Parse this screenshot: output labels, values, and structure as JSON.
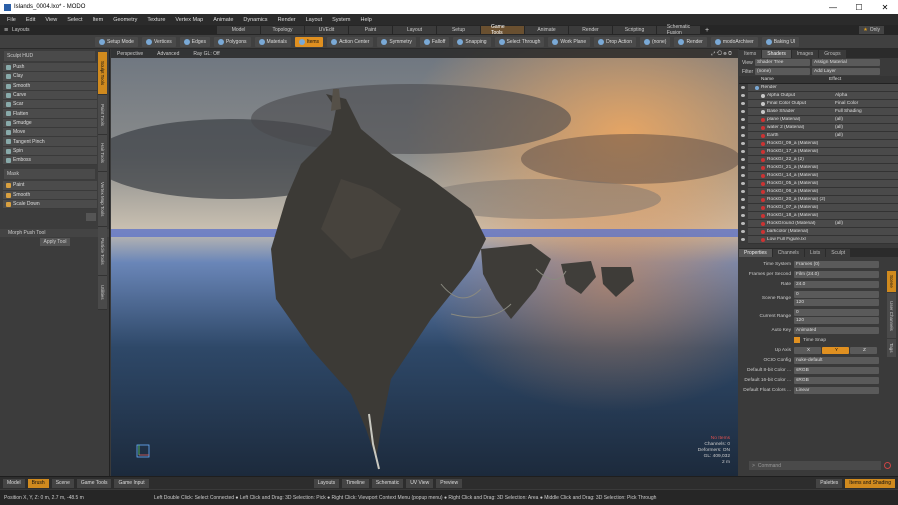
{
  "window": {
    "title": "Islands_0004.lxo* - MODO",
    "min": "—",
    "max": "☐",
    "close": "✕"
  },
  "menu": [
    "File",
    "Edit",
    "View",
    "Select",
    "Item",
    "Geometry",
    "Texture",
    "Vertex Map",
    "Animate",
    "Dynamics",
    "Render",
    "Layout",
    "System",
    "Help"
  ],
  "layouts": {
    "label": "Layouts",
    "tabs": [
      "Model",
      "Topology",
      "UVEdit",
      "Paint",
      "Layout",
      "Setup",
      "Game Tools",
      "Animate",
      "Render",
      "Scripting",
      "Schematic Fusion"
    ],
    "active": "Game Tools",
    "only_label": "Only"
  },
  "toolbar": {
    "items": [
      "Setup Mode",
      "Vertices",
      "Edges",
      "Polygons",
      "Materials",
      "Items",
      "Action Center",
      "Symmetry",
      "Falloff",
      "Snapping",
      "Select Through",
      "Work Plane",
      "Drop Action",
      "(none)",
      "Render",
      "modoArchiver",
      "Baking UI"
    ],
    "active": "Items"
  },
  "left_panel": {
    "header": "Sculpt HUD",
    "tools": [
      "Push",
      "Clay",
      "Smooth",
      "Carve",
      "Scar",
      "Flatten",
      "Smudge",
      "Move",
      "Tangent Pinch",
      "Spin",
      "Emboss"
    ],
    "mask_header": "Mask",
    "mask_tools": [
      "Paint",
      "Smooth",
      "Scale Down"
    ],
    "morph": "Morph Push Tool",
    "apply": "Apply Tool",
    "vtabs": [
      "Sculpt Tools",
      "Paint Tools",
      "Hair Tools",
      "Vertex Map Tools",
      "Particle Tools",
      "Utilities"
    ],
    "vtab_active": "Sculpt Tools"
  },
  "viewport": {
    "view": "Perspective",
    "mode": "Advanced",
    "render": "Ray GL: Off",
    "info": [
      "No Items",
      "Channels: 0",
      "Deformers: ON",
      "GL: 409,032",
      "2 m"
    ]
  },
  "right_panel": {
    "tabs": [
      "Items",
      "Shaders",
      "Images",
      "Groups"
    ],
    "active_tab": "Shaders",
    "view_label": "View",
    "view_value": "Shader Tree",
    "assign": "Assign Material",
    "filter_label": "Filter",
    "filter_value": "(none)",
    "add_layer": "Add Layer",
    "col_name": "Name",
    "col_effect": "Effect",
    "shaders": [
      {
        "name": "Render",
        "effect": "",
        "type": "render"
      },
      {
        "name": "Alpha Output",
        "effect": "Alpha",
        "type": "out"
      },
      {
        "name": "Final Color Output",
        "effect": "Final Color",
        "type": "out"
      },
      {
        "name": "Base Shader",
        "effect": "Full Shading",
        "type": "out"
      },
      {
        "name": "plane (Material)",
        "effect": "(all)",
        "type": "mat"
      },
      {
        "name": "water 2 (Material)",
        "effect": "(all)",
        "type": "mat"
      },
      {
        "name": "Earth",
        "effect": "(all)",
        "type": "mat"
      },
      {
        "name": "RockGr_09_a (Material)",
        "effect": "",
        "type": "mat"
      },
      {
        "name": "RockGr_17_a (Material)",
        "effect": "",
        "type": "mat"
      },
      {
        "name": "RockGr_22_a (2)",
        "effect": "",
        "type": "mat"
      },
      {
        "name": "RockGr_21_a (Material)",
        "effect": "",
        "type": "mat"
      },
      {
        "name": "RockGr_14_a (Material)",
        "effect": "",
        "type": "mat"
      },
      {
        "name": "RockGr_05_a (Material)",
        "effect": "",
        "type": "mat"
      },
      {
        "name": "RockGr_06_a (Material)",
        "effect": "",
        "type": "mat"
      },
      {
        "name": "RockGr_20_a (Material) (2)",
        "effect": "",
        "type": "mat"
      },
      {
        "name": "RockGr_07_a (Material)",
        "effect": "",
        "type": "mat"
      },
      {
        "name": "RockGr_18_a (Material)",
        "effect": "",
        "type": "mat"
      },
      {
        "name": "RockGround (Material)",
        "effect": "(all)",
        "type": "mat"
      },
      {
        "name": "barkcolor (Material)",
        "effect": "",
        "type": "mat"
      },
      {
        "name": "Low Full Figure.lxl",
        "effect": "",
        "type": "mat"
      }
    ],
    "prop_tabs": [
      "Properties",
      "Channels",
      "Lists",
      "Sculpt"
    ],
    "prop_active": "Properties",
    "side_tabs": [
      "Scene",
      "User Channels",
      "Tags"
    ],
    "props": {
      "time_system_label": "Time System",
      "time_system": "Frames (0)",
      "fps_label": "Frames per Second",
      "fps": "Film (24.0)",
      "rate_label": "Rate",
      "rate": "24.0",
      "scene_range_label": "Scene Range",
      "scene_start": "0",
      "scene_end": "120",
      "current_range_label": "Current Range",
      "current_start": "0",
      "current_end": "120",
      "autokey_label": "Auto Key",
      "autokey": "Animated",
      "timesnap": "Time Snap",
      "upaxis_label": "Up Axis",
      "up_x": "X",
      "up_y": "Y",
      "up_z": "Z",
      "ocio_label": "OCIO Config",
      "ocio": "nuke-default",
      "d8_label": "Default 8-bit Color ...",
      "d8": "sRGB",
      "d16_label": "Default 16-bit Color ...",
      "d16": "sRGB",
      "dfloat_label": "Default Float Colors ...",
      "dfloat": "Linear"
    },
    "command_placeholder": "Command"
  },
  "bottom": {
    "left": [
      "Model",
      "Brush",
      "Scene",
      "Game Tools",
      "Game Input"
    ],
    "left_active": "Brush",
    "center": [
      "Layouts",
      "Timeline",
      "Schematic",
      "UV View",
      "Preview"
    ],
    "right": [
      "Palettes",
      "Items and Shading"
    ],
    "right_active": "Items and Shading"
  },
  "status": {
    "position": "Position X, Y, Z:   0 m, 2.7 m, -48.5 m",
    "hint": "Left Double Click: Select Connected ● Left Click and Drag: 3D Selection: Pick ● Right Click: Viewport Context Menu (popup menu) ● Right Click and Drag: 3D Selection: Area ● Middle Click and Drag: 3D Selection: Pick Through"
  }
}
